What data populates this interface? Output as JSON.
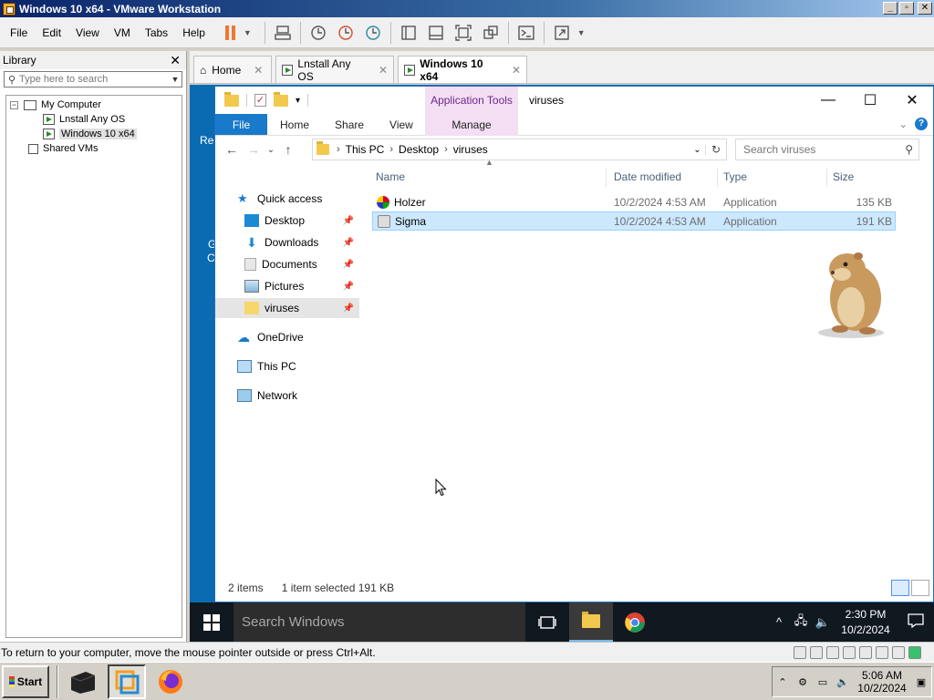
{
  "host_window": {
    "title": "Windows 10 x64 - VMware Workstation",
    "controls": [
      "_",
      "▫",
      "✕"
    ]
  },
  "menu": [
    "File",
    "Edit",
    "View",
    "VM",
    "Tabs",
    "Help"
  ],
  "library": {
    "title": "Library",
    "close": "✕",
    "search_placeholder": "Type here to search",
    "tree": {
      "root": "My Computer",
      "vm1": "Lnstall Any OS",
      "vm2": "Windows 10 x64",
      "shared": "Shared VMs"
    }
  },
  "vm_tabs": [
    {
      "label": "Home",
      "close": "✕"
    },
    {
      "label": "Lnstall Any OS",
      "close": "✕"
    },
    {
      "label": "Windows 10 x64",
      "close": "✕"
    }
  ],
  "guest": {
    "desktop_fragments": [
      "Rec",
      "G",
      "C"
    ],
    "explorer": {
      "context_tab": "Application Tools",
      "title": "viruses",
      "ribbon_tabs": {
        "file": "File",
        "home": "Home",
        "share": "Share",
        "view": "View",
        "manage": "Manage"
      },
      "breadcrumb": [
        "This PC",
        "Desktop",
        "viruses"
      ],
      "search_placeholder": "Search viruses",
      "nav": {
        "quick_access": "Quick access",
        "desktop": "Desktop",
        "downloads": "Downloads",
        "documents": "Documents",
        "pictures": "Pictures",
        "viruses": "viruses",
        "onedrive": "OneDrive",
        "this_pc": "This PC",
        "network": "Network"
      },
      "columns": {
        "name": "Name",
        "date": "Date modified",
        "type": "Type",
        "size": "Size"
      },
      "files": [
        {
          "name": "Holzer",
          "date": "10/2/2024 4:53 AM",
          "type": "Application",
          "size": "135 KB"
        },
        {
          "name": "Sigma",
          "date": "10/2/2024 4:53 AM",
          "type": "Application",
          "size": "191 KB"
        }
      ],
      "status": {
        "items": "2 items",
        "selected": "1 item selected  191 KB"
      }
    },
    "taskbar": {
      "search": "Search Windows",
      "time": "2:30 PM",
      "date": "10/2/2024"
    }
  },
  "host_status": "To return to your computer, move the mouse pointer outside or press Ctrl+Alt.",
  "host_taskbar": {
    "start": "Start",
    "time": "5:06 AM",
    "date": "10/2/2024"
  },
  "colors": {
    "ribbon_file": "#1979ca",
    "context_tab": "#f4def4",
    "selection": "#cce8ff",
    "guest_desktop": "#0a6bb3"
  }
}
